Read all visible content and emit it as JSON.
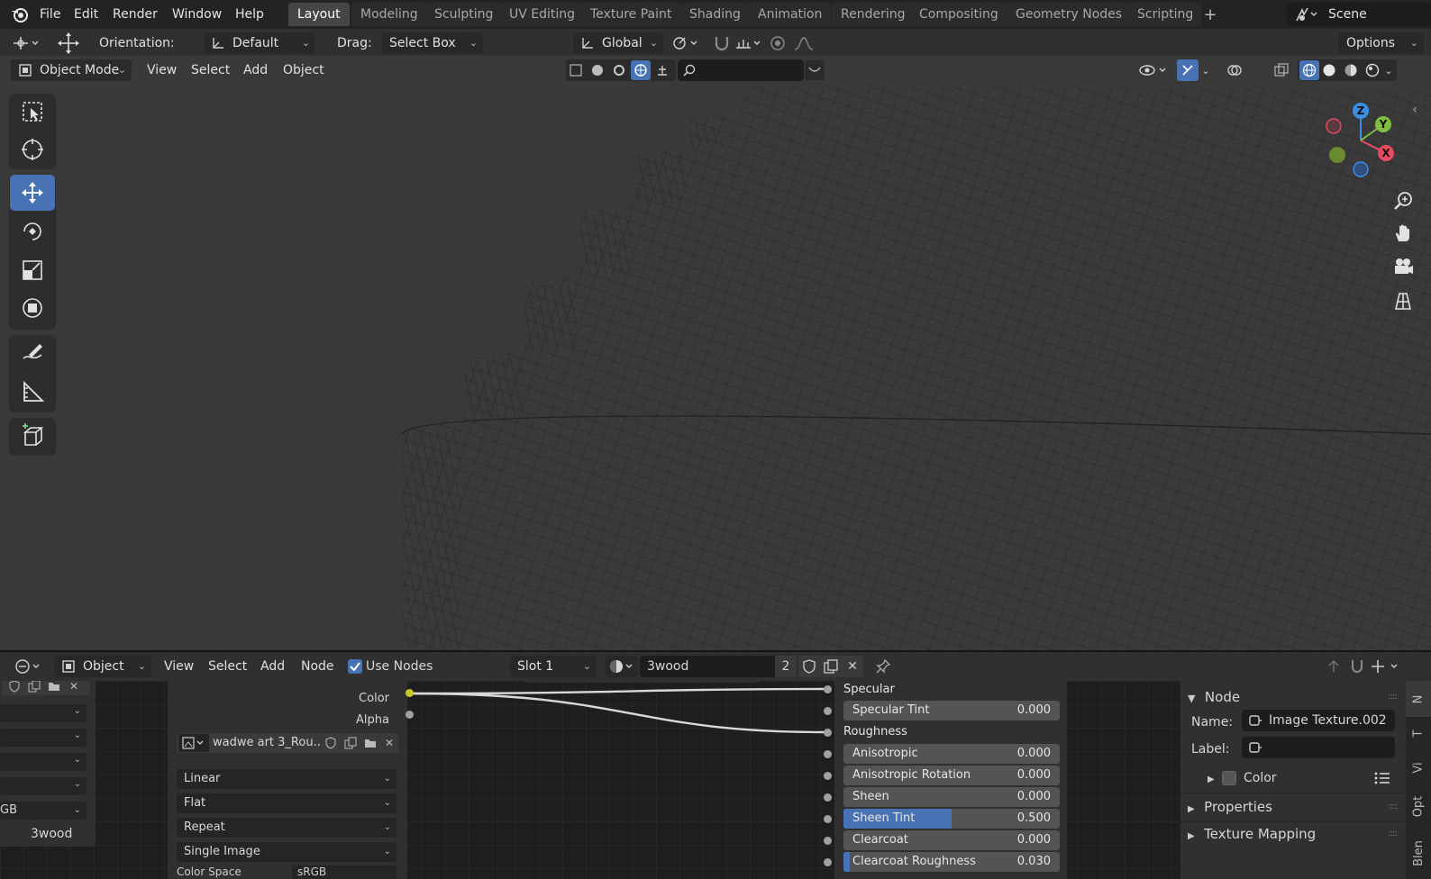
{
  "menus": [
    "File",
    "Edit",
    "Render",
    "Window",
    "Help"
  ],
  "workspaces": [
    "Layout",
    "Modeling",
    "Sculpting",
    "UV Editing",
    "Texture Paint",
    "Shading",
    "Animation",
    "Rendering",
    "Compositing",
    "Geometry Nodes",
    "Scripting"
  ],
  "active_workspace": "Layout",
  "scene_name": "Scene",
  "tool_header": {
    "orientation_label": "Orientation:",
    "orientation_value": "Default",
    "drag_label": "Drag:",
    "drag_value": "Select Box",
    "transform_orientation": "Global",
    "options_label": "Options"
  },
  "viewport_header": {
    "mode": "Object Mode",
    "menus": [
      "View",
      "Select",
      "Add",
      "Object"
    ]
  },
  "gizmo_axes": {
    "x": "X",
    "y": "Y",
    "z": "Z"
  },
  "node_header": {
    "type": "Object",
    "menus": [
      "View",
      "Select",
      "Add",
      "Node"
    ],
    "use_nodes_label": "Use Nodes",
    "use_nodes_checked": true,
    "slot": "Slot 1",
    "material": "3wood",
    "users": "2"
  },
  "left_stub": {
    "colorspace_fragment": "GB",
    "material_label": "3wood"
  },
  "image_node": {
    "outputs": [
      "Color",
      "Alpha"
    ],
    "image_name": "wadwe art 3_Rou...",
    "interpolation": "Linear",
    "projection": "Flat",
    "extension": "Repeat",
    "source": "Single Image",
    "color_space_label": "Color Space",
    "color_space_value": "sRGB"
  },
  "bsdf_inputs": [
    {
      "label": "Specular",
      "value": null
    },
    {
      "label": "Specular Tint",
      "value": "0.000"
    },
    {
      "label": "Roughness",
      "value": null
    },
    {
      "label": "Anisotropic",
      "value": "0.000"
    },
    {
      "label": "Anisotropic Rotation",
      "value": "0.000"
    },
    {
      "label": "Sheen",
      "value": "0.000"
    },
    {
      "label": "Sheen Tint",
      "value": "0.500"
    },
    {
      "label": "Clearcoat",
      "value": "0.000"
    },
    {
      "label": "Clearcoat Roughness",
      "value": "0.030"
    }
  ],
  "sheen_tint_fill": 0.5,
  "clearcoat_roughness_fill": 0.03,
  "node_panel": {
    "title": "Node",
    "name_label": "Name:",
    "name_value": "Image Texture.002",
    "label_label": "Label:",
    "label_value": "",
    "color_label": "Color",
    "properties_label": "Properties",
    "texture_mapping_label": "Texture Mapping"
  },
  "side_tabs": [
    "N",
    "T",
    "Vi",
    "Opt",
    "Blen"
  ],
  "colors": {
    "accent": "#4772b3",
    "yellow_socket": "#c7c729",
    "grey_socket": "#a1a1a1",
    "node_header": "#83432f"
  }
}
